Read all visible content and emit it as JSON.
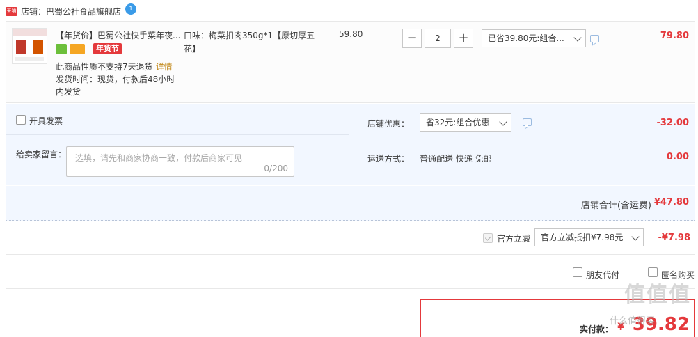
{
  "shop": {
    "logo_text": "天猫",
    "label": "店铺：巴蜀公社食品旗舰店",
    "ww_badge": "1"
  },
  "item": {
    "title": "【年货价】巴蜀公社快手菜年夜...",
    "badge_label": "年货节",
    "return_note": "此商品性质不支持7天退货",
    "detail_link": "详情",
    "ship_time": "发货时间：现货，付款后48小时内发货",
    "spec": "口味：梅菜扣肉350g*1【原切厚五花】",
    "unit_price": "59.80",
    "quantity": "2",
    "minus": "−",
    "plus": "+",
    "promo_select": "已省39.80元:组合...",
    "total": "79.80"
  },
  "extras": {
    "invoice_label": "开具发票",
    "message_label": "给卖家留言：",
    "message_placeholder": "选填，请先和商家协商一致，付款后商家可见",
    "message_count": "0/200",
    "shop_discount_label": "店铺优惠：",
    "shop_discount_select": "省32元:组合优惠",
    "shop_discount_amount": "-32.00",
    "shipping_label": "运送方式：",
    "shipping_value": "普通配送 快递 免邮",
    "shipping_amount": "0.00"
  },
  "shop_total": {
    "label": "店铺合计(含运费)",
    "amount": "¥47.80"
  },
  "official": {
    "label": "官方立减",
    "select": "官方立减抵扣¥7.98元",
    "amount": "-¥7.98"
  },
  "options": {
    "friend_pay": "朋友代付",
    "anonymous": "匿名购买"
  },
  "pay": {
    "label": "实付款：",
    "yen": "¥",
    "amount": "39.82"
  },
  "watermark": {
    "main": "值值值",
    "sub": "什么值得买"
  }
}
